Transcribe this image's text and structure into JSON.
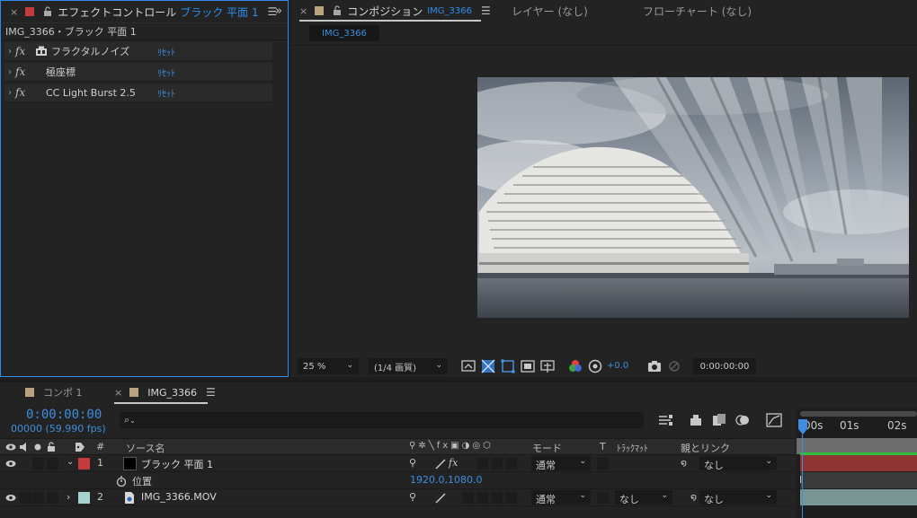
{
  "effect_panel": {
    "tab_label": "エフェクトコントロール",
    "tab_target": "ブラック 平面 1",
    "layer_path": "IMG_3366・ブラック 平面 1",
    "effects": [
      {
        "name": "フラクタルノイズ",
        "reset": "ﾘｾｯﾄ"
      },
      {
        "name": "極座標",
        "reset": "ﾘｾｯﾄ"
      },
      {
        "name": "CC Light Burst 2.5",
        "reset": "ﾘｾｯﾄ"
      }
    ],
    "colors": {
      "accent": "#2d8ceb",
      "tab_swatch": "#c43b3b"
    }
  },
  "composition_panel": {
    "tab_label": "コンポジション",
    "tab_target": "IMG_3366",
    "layer_tab": "レイヤー (なし)",
    "flowchart_tab": "フローチャート (なし)",
    "sub_tab": "IMG_3366",
    "toolbar": {
      "zoom": "25 %",
      "resolution": "(1/4 画質)",
      "exposure": "+0.0",
      "timecode": "0:00:00:00"
    }
  },
  "timeline": {
    "tabs": [
      {
        "label": "コンポ 1"
      },
      {
        "label": "IMG_3366"
      }
    ],
    "timecode": "0:00:00:00",
    "timecode_fps": "00000 (59.990 fps)",
    "search_glyph": "⌕",
    "columns": {
      "num": "#",
      "source_name": "ソース名",
      "mode": "モード",
      "t": "T",
      "track_matte": "ﾄﾗｯｸﾏｯﾄ",
      "parent_link": "親とリンク"
    },
    "ruler_labels": [
      "00s",
      "01s",
      "02s"
    ],
    "layers": [
      {
        "num": "1",
        "name": "ブラック 平面 1",
        "mode": "通常",
        "parent": "なし",
        "label_color": "#c43b3b"
      },
      {
        "num": "2",
        "name": "IMG_3366.MOV",
        "mode": "通常",
        "track_matte": "なし",
        "parent": "なし",
        "label_color": "#a6d3cf"
      }
    ],
    "position_property": {
      "label": "位置",
      "value": "1920.0,1080.0"
    }
  }
}
